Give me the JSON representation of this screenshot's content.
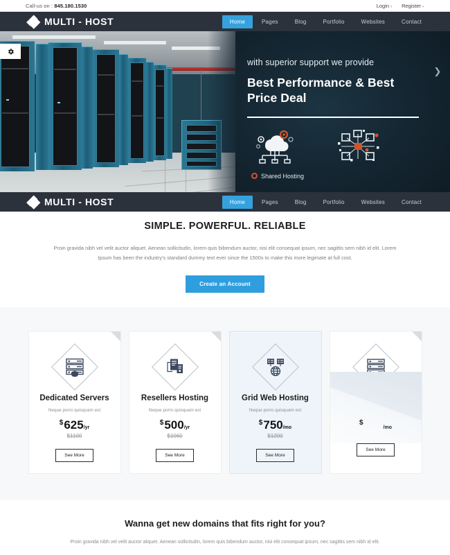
{
  "topbar": {
    "call_prefix": "Call-us on :",
    "phone": "845.180.1530",
    "login": "Login",
    "register": "Register",
    "chevron": "›"
  },
  "brand": {
    "name": "MULTI - HOST",
    "logo_icon": "diamond-cluster-icon"
  },
  "nav": {
    "items": [
      {
        "label": "Home",
        "active": true
      },
      {
        "label": "Pages",
        "active": false
      },
      {
        "label": "Blog",
        "active": false
      },
      {
        "label": "Portfolio",
        "active": false
      },
      {
        "label": "Websites",
        "active": false
      },
      {
        "label": "Contact",
        "active": false
      }
    ],
    "active_color": "#36a2dd",
    "bar_color": "#2b323c"
  },
  "hero": {
    "subtitle": "with superior support we provide",
    "title_line1": "Best Performance & Best",
    "title_line2": "Price Deal",
    "tag": "Shared Hosting",
    "tag_dot_color": "#d2542c",
    "icons": [
      "cloud-network-icon",
      "node-network-icon"
    ],
    "next_arrow": "❯",
    "settings_icon": "gear-icon",
    "photo_alt": "data-center-server-racks"
  },
  "intro": {
    "heading": "SIMPLE. POWERFUL. RELIABLE",
    "paragraph": "Proin gravida nibh vel velit auctor aliquet. Aenean sollicitudin, lorem quis bibendum auctor, nisi elit consequat ipsum, nec sagittis sem nibh id elit. Lorem Ipsum has been the industry's standard dummy text ever since the 1500s to make this more legimate at full cost.",
    "cta_label": "Create an Account",
    "cta_color": "#2e9ede"
  },
  "pricing": {
    "background": "#f7f8f9",
    "cards": [
      {
        "title": "Dedicated Servers",
        "desc": "Neque porro quisquam est",
        "currency": "$",
        "amount": "625",
        "period": "/yr",
        "old_price": "$1100",
        "button": "See More",
        "icon": "server-shield-icon",
        "featured": false,
        "loading": false
      },
      {
        "title": "Resellers Hosting",
        "desc": "Neque porro quisquam est",
        "currency": "$",
        "amount": "500",
        "period": "/yr",
        "old_price": "$1060",
        "button": "See More",
        "icon": "two-servers-icon",
        "featured": false,
        "loading": false
      },
      {
        "title": "Grid Web Hosting",
        "desc": "Neque porro quisquam est",
        "currency": "$",
        "amount": "750",
        "period": "/mo",
        "old_price": "$1200",
        "button": "See More",
        "icon": "servers-globe-icon",
        "featured": true,
        "loading": false
      },
      {
        "title": "",
        "desc": "",
        "currency": "$",
        "amount": "",
        "period": "/mo",
        "old_price": "",
        "button": "See More",
        "icon": "server-stack-icon",
        "featured": false,
        "loading": true
      }
    ]
  },
  "promo": {
    "heading": "Wanna get new domains that fits right for you?",
    "paragraph": "Proin gravida nibh vel velit auctor aliquet. Aenean sollicitudin, lorem quis bibendum auctor, nisi elit consequat ipsum, nec sagittis sem nibh id elit."
  }
}
